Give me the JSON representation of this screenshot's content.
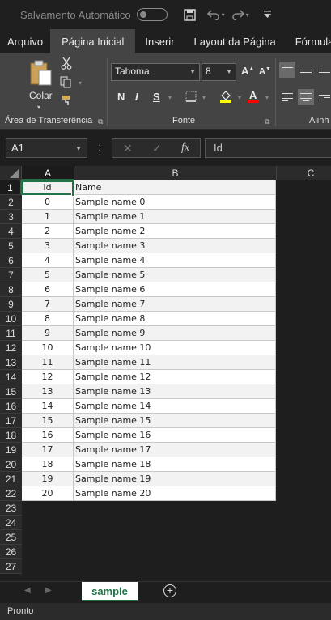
{
  "titlebar": {
    "autosave_label": "Salvamento Automático",
    "autosave_state": "off",
    "icons": [
      "save-icon",
      "undo-icon",
      "redo-icon",
      "customize-toolbar-icon"
    ]
  },
  "ribbon_tabs": [
    {
      "label": "Arquivo",
      "active": false
    },
    {
      "label": "Página Inicial",
      "active": true
    },
    {
      "label": "Inserir",
      "active": false
    },
    {
      "label": "Layout da Página",
      "active": false
    },
    {
      "label": "Fórmulas",
      "active": false
    }
  ],
  "ribbon": {
    "clipboard": {
      "paste_label": "Colar",
      "group_label": "Área de Transferência"
    },
    "font": {
      "font_name": "Tahoma",
      "font_size": "8",
      "bold": "N",
      "italic": "I",
      "underline": "S",
      "group_label": "Fonte",
      "fill_color": "#ffff00",
      "font_color": "#ff0000"
    },
    "alignment": {
      "group_label": "Alinh"
    }
  },
  "formula_bar": {
    "name_box": "A1",
    "fx": "fx",
    "content": "Id"
  },
  "grid": {
    "column_headers": [
      "A",
      "B",
      "C"
    ],
    "active_column": "A",
    "active_row": "1",
    "row_numbers": [
      "1",
      "2",
      "3",
      "4",
      "5",
      "6",
      "7",
      "8",
      "9",
      "10",
      "11",
      "12",
      "13",
      "14",
      "15",
      "16",
      "17",
      "18",
      "19",
      "20",
      "21",
      "22",
      "23",
      "24",
      "25",
      "26",
      "27"
    ],
    "rows": [
      {
        "a": "Id",
        "b": "Name"
      },
      {
        "a": "0",
        "b": "Sample name 0"
      },
      {
        "a": "1",
        "b": "Sample name 1"
      },
      {
        "a": "2",
        "b": "Sample name 2"
      },
      {
        "a": "3",
        "b": "Sample name 3"
      },
      {
        "a": "4",
        "b": "Sample name 4"
      },
      {
        "a": "5",
        "b": "Sample name 5"
      },
      {
        "a": "6",
        "b": "Sample name 6"
      },
      {
        "a": "7",
        "b": "Sample name 7"
      },
      {
        "a": "8",
        "b": "Sample name 8"
      },
      {
        "a": "9",
        "b": "Sample name 9"
      },
      {
        "a": "10",
        "b": "Sample name 10"
      },
      {
        "a": "11",
        "b": "Sample name 11"
      },
      {
        "a": "12",
        "b": "Sample name 12"
      },
      {
        "a": "13",
        "b": "Sample name 13"
      },
      {
        "a": "14",
        "b": "Sample name 14"
      },
      {
        "a": "15",
        "b": "Sample name 15"
      },
      {
        "a": "16",
        "b": "Sample name 16"
      },
      {
        "a": "17",
        "b": "Sample name 17"
      },
      {
        "a": "18",
        "b": "Sample name 18"
      },
      {
        "a": "19",
        "b": "Sample name 19"
      },
      {
        "a": "20",
        "b": "Sample name 20"
      }
    ]
  },
  "sheets": {
    "tabs": [
      {
        "label": "sample",
        "active": true
      }
    ],
    "accent": "#217346"
  },
  "status": {
    "text": "Pronto"
  }
}
